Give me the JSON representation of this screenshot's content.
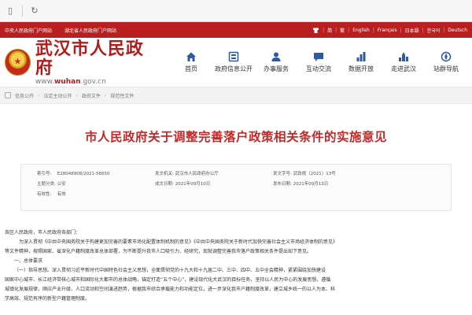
{
  "topbar": {
    "links": [
      "中央人民政府门户网站",
      "湖北省人民政府门户网站"
    ],
    "lang": [
      "简",
      "繁",
      "English",
      "Français",
      "日本語",
      "한국어",
      "Deutsch"
    ]
  },
  "header": {
    "title": "武汉市人民政府",
    "url_prefix": "www.",
    "url_main": "wuhan",
    "url_suffix": ".gov.cn"
  },
  "nav": [
    {
      "label": "首页",
      "icon": "home-icon"
    },
    {
      "label": "政府信息公开",
      "icon": "info-icon"
    },
    {
      "label": "办事服务",
      "icon": "service-icon"
    },
    {
      "label": "互动交流",
      "icon": "chat-icon"
    },
    {
      "label": "数据开放",
      "icon": "data-icon"
    },
    {
      "label": "走进武汉",
      "icon": "city-icon"
    },
    {
      "label": "站群导航",
      "icon": "nav-icon"
    }
  ],
  "breadcrumb": [
    "信息公开",
    "法定主动公开",
    "政府文件",
    "规范性文件"
  ],
  "article": {
    "title": "市人民政府关于调整完善落户政策相关条件的实施意见",
    "meta": {
      "index_label": "索引号:",
      "index_value": "E28048908/2021-56650",
      "issuer_label": "发文机关:",
      "issuer_value": "武汉市人民政府办公厅",
      "docno_label": "发文字号:",
      "docno_value": "武政规〔2021〕13号",
      "category_label": "主题分类:",
      "category_value": "公安",
      "created_label": "成文日期:",
      "created_value": "2021年09月10日",
      "pubdate_label": "发布日期:",
      "pubdate_value": "2021年09月13日",
      "validity_label": "有效性:",
      "validity_value": "有效"
    },
    "paragraphs": [
      "各区人民政府，市人民政府各部门：",
      "为深入贯彻《中共中央国务院关于构建更加完善的要素市场化配置体制机制的意见》《中共中央国务院关于新时代加快完善社会主义市场经济体制的意见》",
      "等文件精神，按照国家、省深化户籍制度改革总体部署，为不断提升我市人口吸引力、经研究，现就调整完善我市落户政策相关条件提出如下意见。",
      "一、总体要求",
      "（一）指导思想。深入贯彻习近平新时代中国特色社会主义思想，全面贯彻党的十九大和十九届二中、三中、四中、五中全会精神，紧紧围绕加快建设",
      "国家中心城市、长江经济带核心城市和国际化大都市的总体战略，锚定打造“五个中心”，建设现代化大武汉的目标任务，坚持以人民为中心的发展思想，遵循",
      "城镇化发展规律，顺应产业升级、人口流动和空间演进趋势，根据我市综合承载能力和功能定位，进一步深化我市户籍制度改革，建立城乡统一的以人为本、科",
      "学高效、规范有序的新型户籍管理制度。"
    ]
  }
}
